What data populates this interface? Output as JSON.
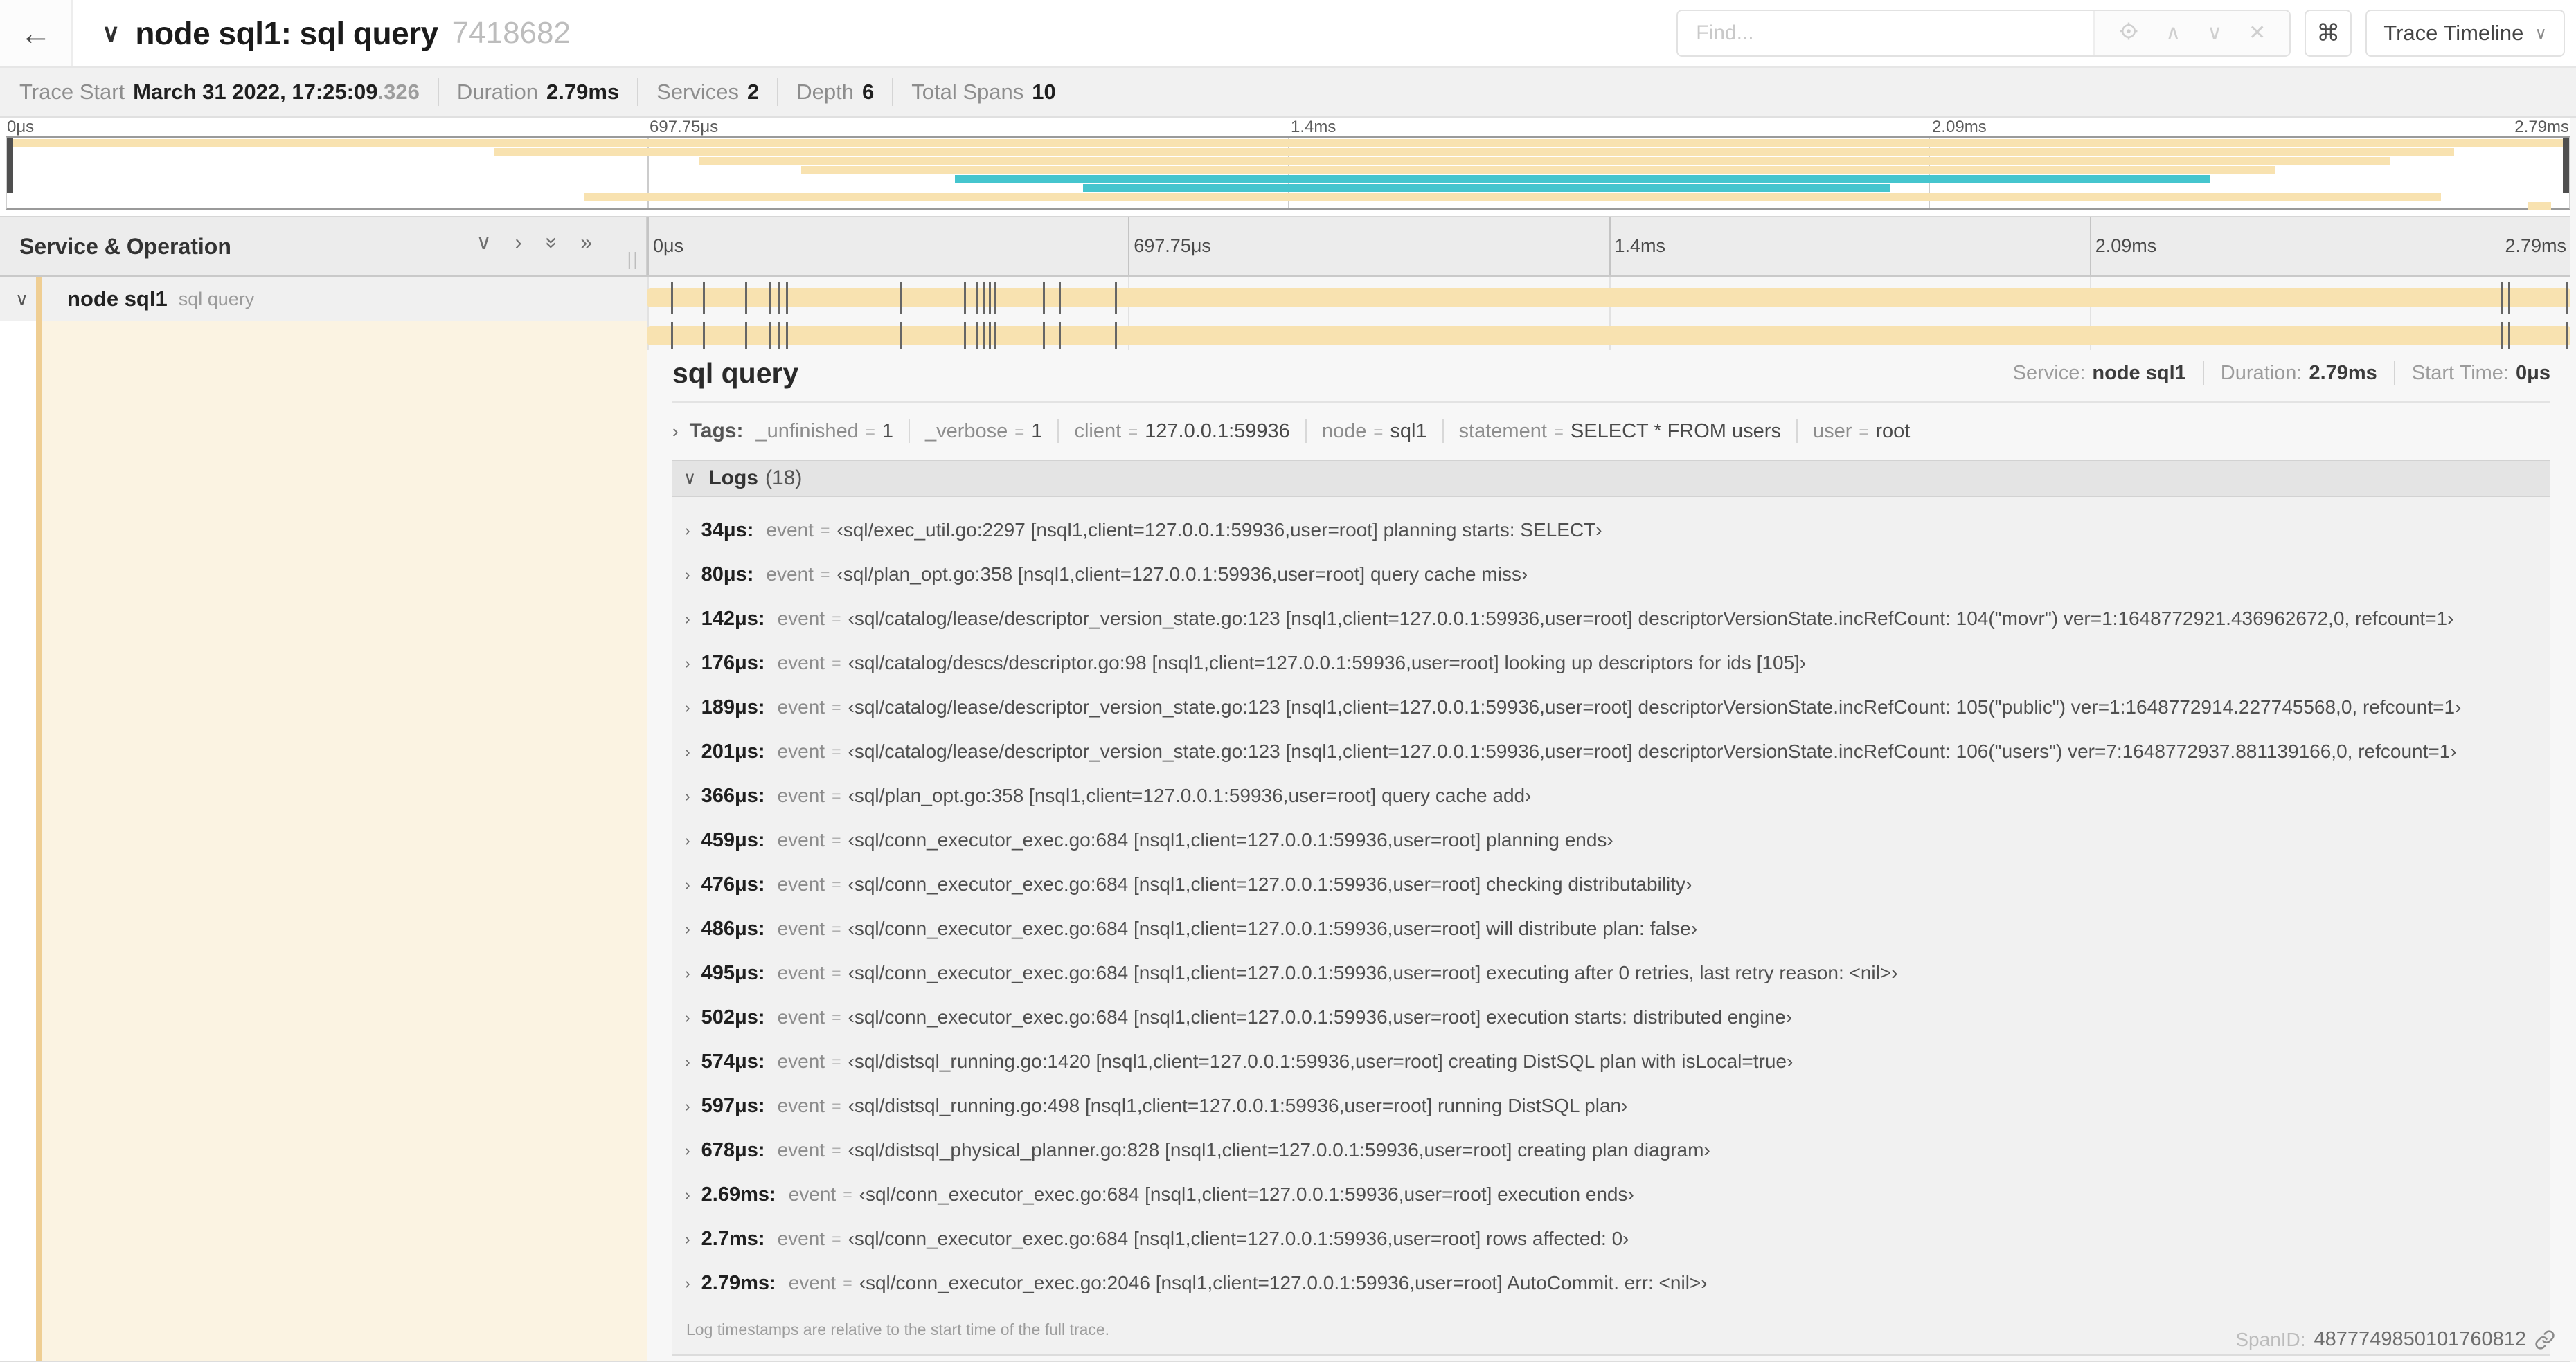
{
  "header": {
    "back_icon": "←",
    "collapse_icon": "∨",
    "title": "node sql1: sql query",
    "trace_id_short": "7418682",
    "find_placeholder": "Find...",
    "shortcut_button": "⌘",
    "view_selector": "Trace Timeline"
  },
  "summary": {
    "items": [
      {
        "label": "Trace Start",
        "value": "March 31 2022, 17:25:09",
        "suffix": ".326"
      },
      {
        "label": "Duration",
        "value": "2.79ms"
      },
      {
        "label": "Services",
        "value": "2"
      },
      {
        "label": "Depth",
        "value": "6"
      },
      {
        "label": "Total Spans",
        "value": "10"
      }
    ]
  },
  "timeline": {
    "ticks": [
      "0μs",
      "697.75μs",
      "1.4ms",
      "2.09ms",
      "2.79ms"
    ],
    "tick_positions": [
      0,
      25,
      50,
      75,
      100
    ],
    "column_header": "Service & Operation",
    "row": {
      "service": "node sql1",
      "operation": "sql query"
    },
    "duration_us": 2790,
    "minimap_spans": [
      {
        "start": 0,
        "end": 100,
        "color": "tan"
      },
      {
        "start": 19,
        "end": 95.5,
        "color": "tan"
      },
      {
        "start": 27,
        "end": 93,
        "color": "tan"
      },
      {
        "start": 31,
        "end": 88.5,
        "color": "tan"
      },
      {
        "start": 37,
        "end": 86,
        "color": "teal"
      },
      {
        "start": 42,
        "end": 73.5,
        "color": "teal"
      },
      {
        "start": 22.5,
        "end": 95,
        "color": "tan"
      },
      {
        "start": 98.4,
        "end": 99.3,
        "color": "tan"
      }
    ]
  },
  "detail": {
    "title": "sql query",
    "meta": [
      {
        "label": "Service:",
        "value": "node sql1"
      },
      {
        "label": "Duration:",
        "value": "2.79ms"
      },
      {
        "label": "Start Time:",
        "value": "0μs"
      }
    ],
    "tags_label": "Tags:",
    "tags": [
      {
        "key": "_unfinished",
        "value": "1"
      },
      {
        "key": "_verbose",
        "value": "1"
      },
      {
        "key": "client",
        "value": "127.0.0.1:59936"
      },
      {
        "key": "node",
        "value": "sql1"
      },
      {
        "key": "statement",
        "value": "SELECT * FROM users"
      },
      {
        "key": "user",
        "value": "root"
      }
    ],
    "logs_label": "Logs",
    "logs_count": "(18)",
    "log_field_key": "event",
    "logs": [
      {
        "t": "34μs:",
        "event": "‹sql/exec_util.go:2297 [nsql1,client=127.0.0.1:59936,user=root] planning starts: SELECT›"
      },
      {
        "t": "80μs:",
        "event": "‹sql/plan_opt.go:358 [nsql1,client=127.0.0.1:59936,user=root] query cache miss›"
      },
      {
        "t": "142μs:",
        "event": "‹sql/catalog/lease/descriptor_version_state.go:123 [nsql1,client=127.0.0.1:59936,user=root] descriptorVersionState.incRefCount: 104(\"movr\") ver=1:1648772921.436962672,0, refcount=1›"
      },
      {
        "t": "176μs:",
        "event": "‹sql/catalog/descs/descriptor.go:98 [nsql1,client=127.0.0.1:59936,user=root] looking up descriptors for ids [105]›"
      },
      {
        "t": "189μs:",
        "event": "‹sql/catalog/lease/descriptor_version_state.go:123 [nsql1,client=127.0.0.1:59936,user=root] descriptorVersionState.incRefCount: 105(\"public\") ver=1:1648772914.227745568,0, refcount=1›"
      },
      {
        "t": "201μs:",
        "event": "‹sql/catalog/lease/descriptor_version_state.go:123 [nsql1,client=127.0.0.1:59936,user=root] descriptorVersionState.incRefCount: 106(\"users\") ver=7:1648772937.881139166,0, refcount=1›"
      },
      {
        "t": "366μs:",
        "event": "‹sql/plan_opt.go:358 [nsql1,client=127.0.0.1:59936,user=root] query cache add›"
      },
      {
        "t": "459μs:",
        "event": "‹sql/conn_executor_exec.go:684 [nsql1,client=127.0.0.1:59936,user=root] planning ends›"
      },
      {
        "t": "476μs:",
        "event": "‹sql/conn_executor_exec.go:684 [nsql1,client=127.0.0.1:59936,user=root] checking distributability›"
      },
      {
        "t": "486μs:",
        "event": "‹sql/conn_executor_exec.go:684 [nsql1,client=127.0.0.1:59936,user=root] will distribute plan: false›"
      },
      {
        "t": "495μs:",
        "event": "‹sql/conn_executor_exec.go:684 [nsql1,client=127.0.0.1:59936,user=root] executing after 0 retries, last retry reason: <nil>›"
      },
      {
        "t": "502μs:",
        "event": "‹sql/conn_executor_exec.go:684 [nsql1,client=127.0.0.1:59936,user=root] execution starts: distributed engine›"
      },
      {
        "t": "574μs:",
        "event": "‹sql/distsql_running.go:1420 [nsql1,client=127.0.0.1:59936,user=root] creating DistSQL plan with isLocal=true›"
      },
      {
        "t": "597μs:",
        "event": "‹sql/distsql_running.go:498 [nsql1,client=127.0.0.1:59936,user=root] running DistSQL plan›"
      },
      {
        "t": "678μs:",
        "event": "‹sql/distsql_physical_planner.go:828 [nsql1,client=127.0.0.1:59936,user=root] creating plan diagram›"
      },
      {
        "t": "2.69ms:",
        "event": "‹sql/conn_executor_exec.go:684 [nsql1,client=127.0.0.1:59936,user=root] execution ends›"
      },
      {
        "t": "2.7ms:",
        "event": "‹sql/conn_executor_exec.go:684 [nsql1,client=127.0.0.1:59936,user=root] rows affected: 0›"
      },
      {
        "t": "2.79ms:",
        "event": "‹sql/conn_executor_exec.go:2046 [nsql1,client=127.0.0.1:59936,user=root] AutoCommit. err: <nil>›"
      }
    ],
    "logs_footer": "Log timestamps are relative to the start time of the full trace.",
    "spanid_label": "SpanID:",
    "spanid_value": "4877749850101760812"
  },
  "colors": {
    "tan": "#f8e2b0",
    "teal": "#45c5ce",
    "stripe": "#efce93",
    "detail_column": "#fbf3e2",
    "marker": "#666666"
  }
}
